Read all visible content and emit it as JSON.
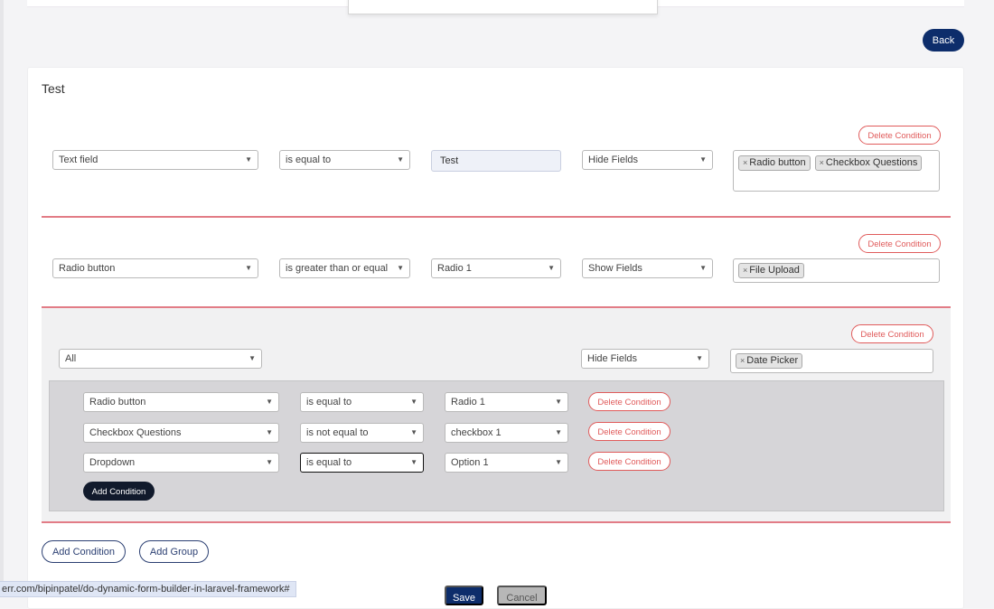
{
  "header": {
    "back_label": "Back"
  },
  "card": {
    "title": "Test"
  },
  "conditions": [
    {
      "field": "Text field",
      "operator": "is equal to",
      "value": "Test",
      "action": "Hide Fields",
      "targets": [
        "Radio button",
        "Checkbox Questions"
      ],
      "delete_label": "Delete Condition"
    },
    {
      "field": "Radio button",
      "operator": "is greater than or equal",
      "value": "Radio 1",
      "action": "Show Fields",
      "targets": [
        "File Upload"
      ],
      "delete_label": "Delete Condition"
    }
  ],
  "group": {
    "match": "All",
    "action": "Hide Fields",
    "targets": [
      "Date Picker"
    ],
    "delete_label": "Delete Condition",
    "rows": [
      {
        "field": "Radio button",
        "operator": "is equal to",
        "value": "Radio 1",
        "delete_label": "Delete Condition"
      },
      {
        "field": "Checkbox Questions",
        "operator": "is not equal to",
        "value": "checkbox 1",
        "delete_label": "Delete Condition"
      },
      {
        "field": "Dropdown",
        "operator": "is equal to",
        "value": "Option 1",
        "delete_label": "Delete Condition"
      }
    ],
    "add_condition_label": "Add Condition"
  },
  "footer": {
    "add_condition_label": "Add Condition",
    "add_group_label": "Add Group",
    "save_label": "Save",
    "cancel_label": "Cancel"
  },
  "status_bar": {
    "url": "err.com/bipinpatel/do-dynamic-form-builder-in-laravel-framework#"
  },
  "icons": {
    "dropdown_arrow": "chevron-down-icon",
    "tag_remove": "close-icon"
  },
  "colors": {
    "primary": "#0d2d6b",
    "danger": "#e05b5b",
    "separator": "#e27c86"
  }
}
